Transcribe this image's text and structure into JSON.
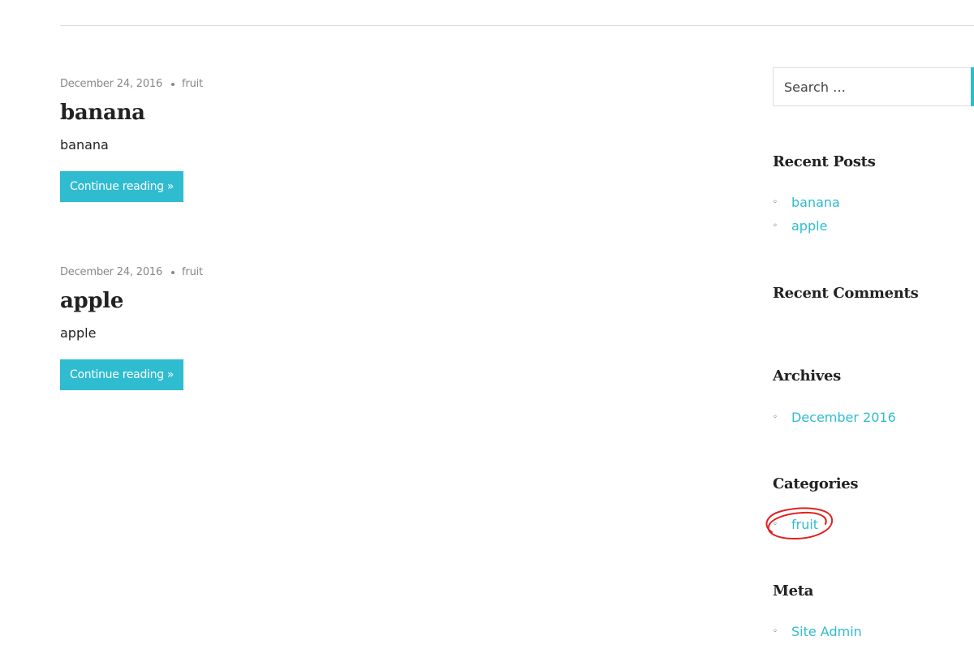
{
  "posts": [
    {
      "date": "December 24, 2016",
      "category": "fruit",
      "title": "banana",
      "excerpt": "banana",
      "more_label": "Continue reading »"
    },
    {
      "date": "December 24, 2016",
      "category": "fruit",
      "title": "apple",
      "excerpt": "apple",
      "more_label": "Continue reading »"
    }
  ],
  "sidebar": {
    "search": {
      "placeholder": "Search …",
      "value": ""
    },
    "recent_posts": {
      "title": "Recent Posts",
      "items": [
        "banana",
        "apple"
      ]
    },
    "recent_comments": {
      "title": "Recent Comments"
    },
    "archives": {
      "title": "Archives",
      "items": [
        "December 2016"
      ]
    },
    "categories": {
      "title": "Categories",
      "items": [
        "fruit"
      ]
    },
    "meta": {
      "title": "Meta",
      "items": [
        "Site Admin"
      ]
    }
  },
  "colors": {
    "accent": "#2fbcd0",
    "annotation": "#e02020",
    "text": "#222222",
    "muted": "#888888"
  },
  "icons": {
    "list_bullet": "◦"
  }
}
